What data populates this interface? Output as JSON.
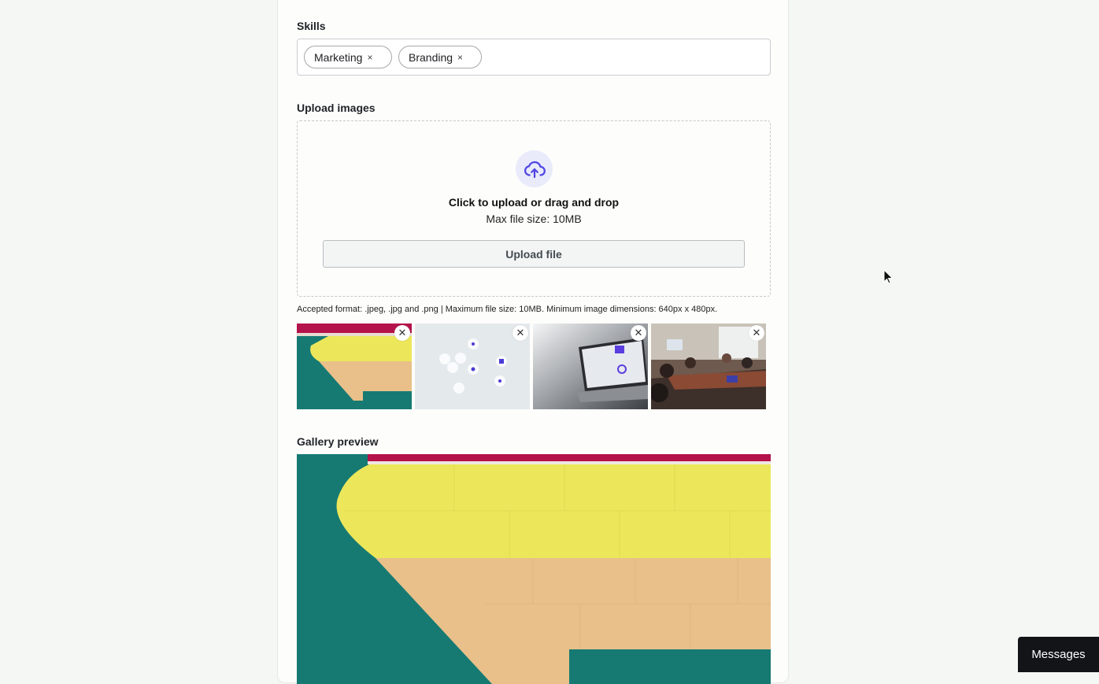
{
  "skills": {
    "label": "Skills",
    "chips": [
      {
        "label": "Marketing",
        "remove": "×"
      },
      {
        "label": "Branding",
        "remove": "×"
      }
    ]
  },
  "upload": {
    "label": "Upload images",
    "icon": "cloud-upload-icon",
    "title": "Click to upload or drag and drop",
    "subtitle": "Max file size: 10MB",
    "button_label": "Upload file",
    "accepted_text": "Accepted format: .jpeg, .jpg and .png | Maximum file size: 10MB. Minimum image dimensions: 640px x 480px.",
    "accent_color": "#5046e5"
  },
  "thumbnails": [
    {
      "remove": "✕"
    },
    {
      "remove": "✕"
    },
    {
      "remove": "✕"
    },
    {
      "remove": "✕"
    }
  ],
  "gallery": {
    "label": "Gallery preview"
  },
  "messages_button": {
    "label": "Messages"
  }
}
